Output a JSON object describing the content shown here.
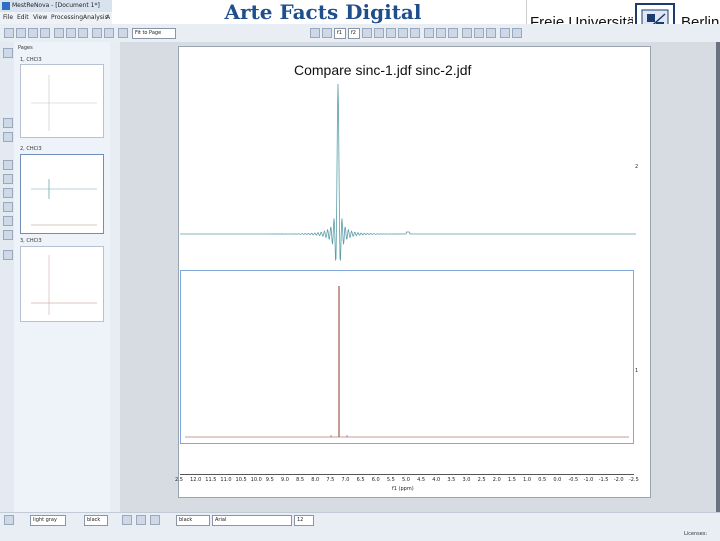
{
  "window": {
    "title": "MestReNova - [Document 1*]"
  },
  "menu": [
    "File",
    "Edit",
    "View",
    "Processing",
    "Analysis",
    "A"
  ],
  "slide": {
    "title": "Arte Facts Digital Resolution"
  },
  "logo": {
    "left_text": "Freie Universität",
    "right_text": "Berlin"
  },
  "toolbar": {
    "fit_select": "Fit to Page",
    "btn_f1": "f1",
    "btn_f2": "f2"
  },
  "pages_pane": {
    "label": "Pages",
    "items": [
      {
        "label": "1, CHCl3"
      },
      {
        "label": "2, CHCl3"
      },
      {
        "label": "3, CHCl3"
      }
    ]
  },
  "document": {
    "caption": "Compare  sinc-1.jdf sinc-2.jdf",
    "spectrum1_trace_label": "2",
    "spectrum2_trace_label": "1",
    "x_axis_title": "f1 (ppm)",
    "x_ticks": [
      "2.5",
      "12.0",
      "11.5",
      "11.0",
      "10.5",
      "10.0",
      "9.5",
      "9.0",
      "8.5",
      "8.0",
      "7.5",
      "7.0",
      "6.5",
      "6.0",
      "5.5",
      "5.0",
      "4.5",
      "4.0",
      "3.5",
      "3.0",
      "2.5",
      "2.0",
      "1.5",
      "1.0",
      "0.5",
      "0.0",
      "-0.5",
      "-1.0",
      "-1.5",
      "-2.0",
      "-2.5"
    ]
  },
  "statusbar": {
    "color_select": "light gray",
    "fill_select": "black",
    "line_select": "black",
    "font_select": "Arial",
    "size_select": "12",
    "license_text": "Licenses:"
  },
  "colors": {
    "spectrum1": "#5c9ea8",
    "spectrum2": "#8b3a2a",
    "frame": "#7fa8d8",
    "title": "#1f4e8c"
  }
}
